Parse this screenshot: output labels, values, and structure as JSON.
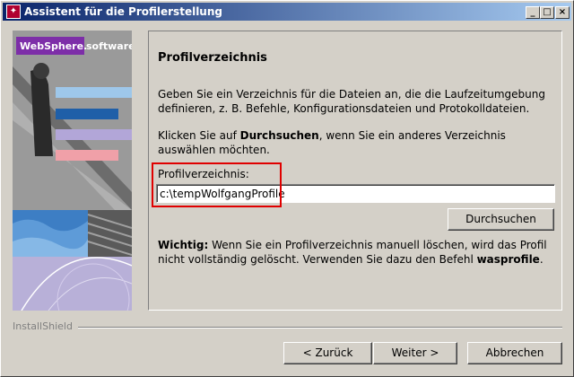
{
  "window": {
    "title": "Assistent für die Profilerstellung",
    "controls": [
      "minimize-icon",
      "maximize-icon",
      "close-icon"
    ]
  },
  "banner": {
    "brand": "WebSphere.",
    "brand_suffix": "software"
  },
  "panel": {
    "heading": "Profilverzeichnis",
    "paragraph1": "Geben Sie ein Verzeichnis für die Dateien an, die die Laufzeitumgebung definieren, z. B. Befehle, Konfigurationsdateien und Protokolldateien.",
    "paragraph2_pre": "Klicken Sie auf ",
    "paragraph2_bold": "Durchsuchen",
    "paragraph2_post": ", wenn Sie ein anderes Verzeichnis auswählen möchten.",
    "field_label": "Profilverzeichnis:",
    "field_value": "c:\\tempWolfgangProfile",
    "browse_button": "Durchsuchen",
    "note_bold": "Wichtig:",
    "note_text": " Wenn Sie ein Profilverzeichnis manuell löschen, wird das Profil nicht vollständig gelöscht. Verwenden Sie dazu den Befehl ",
    "note_command": "wasprofile",
    "note_end": "."
  },
  "footer": {
    "brand": "InstallShield",
    "back": "< Zurück",
    "next": "Weiter >",
    "cancel": "Abbrechen"
  },
  "colors": {
    "title_start": "#0a246a",
    "title_end": "#a6caf0",
    "brand_purple": "#7d2ea8",
    "highlight": "#e00000"
  }
}
